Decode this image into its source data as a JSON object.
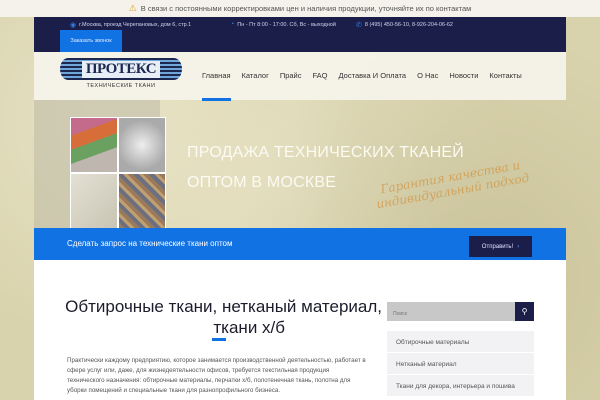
{
  "notice": {
    "icon": "warning-icon",
    "text": "В связи с постоянными корректировками цен и наличия продукции, уточняйте их по контактам"
  },
  "topbar": {
    "address": "г.Москва, проезд Черепановых, дом 6, стр.1",
    "hours": "Пн - Пт 8:00 - 17:00. Сб, Вс - выходной",
    "phone": "8 (495) 450-56-10, 8-926-204-06-62",
    "call_button": "Заказать звонок"
  },
  "logo": {
    "name": "ПРОТЕКС",
    "subtitle": "ТЕХНИЧЕСКИЕ ТКАНИ"
  },
  "nav": [
    "Главная",
    "Каталог",
    "Прайс",
    "FAQ",
    "Доставка И Оплата",
    "О Нас",
    "Новости",
    "Контакты"
  ],
  "hero": {
    "line1": "ПРОДАЖА ТЕХНИЧЕСКИХ ТКАНЕЙ",
    "line2": "ОПТОМ В МОСКВЕ",
    "script1": "Гарантия качества и",
    "script2": "индивидуальный подход"
  },
  "cta": {
    "text": "Сделать запрос на технические ткани оптом",
    "button": "Отправить!"
  },
  "main": {
    "title1": "Обтирочные ткани, нетканый материал,",
    "title2": "ткани х/б",
    "body": "Практически каждому предприятию, которое занимается производственной деятельностью, работает в сфере услуг или, даже, для жизнедеятельности офисов, требуется текстильная продукция технического назначения: обтирочные материалы, перчатки х/б, полотенечная ткань, полотна для уборки помещений и специальные ткани для разнопрофильного бизнеса."
  },
  "sidebar": {
    "search_placeholder": "Поиск",
    "items": [
      "Обтирочные материалы",
      "Нетканый материал",
      "Ткани для декора, интерьера и пошива"
    ]
  }
}
